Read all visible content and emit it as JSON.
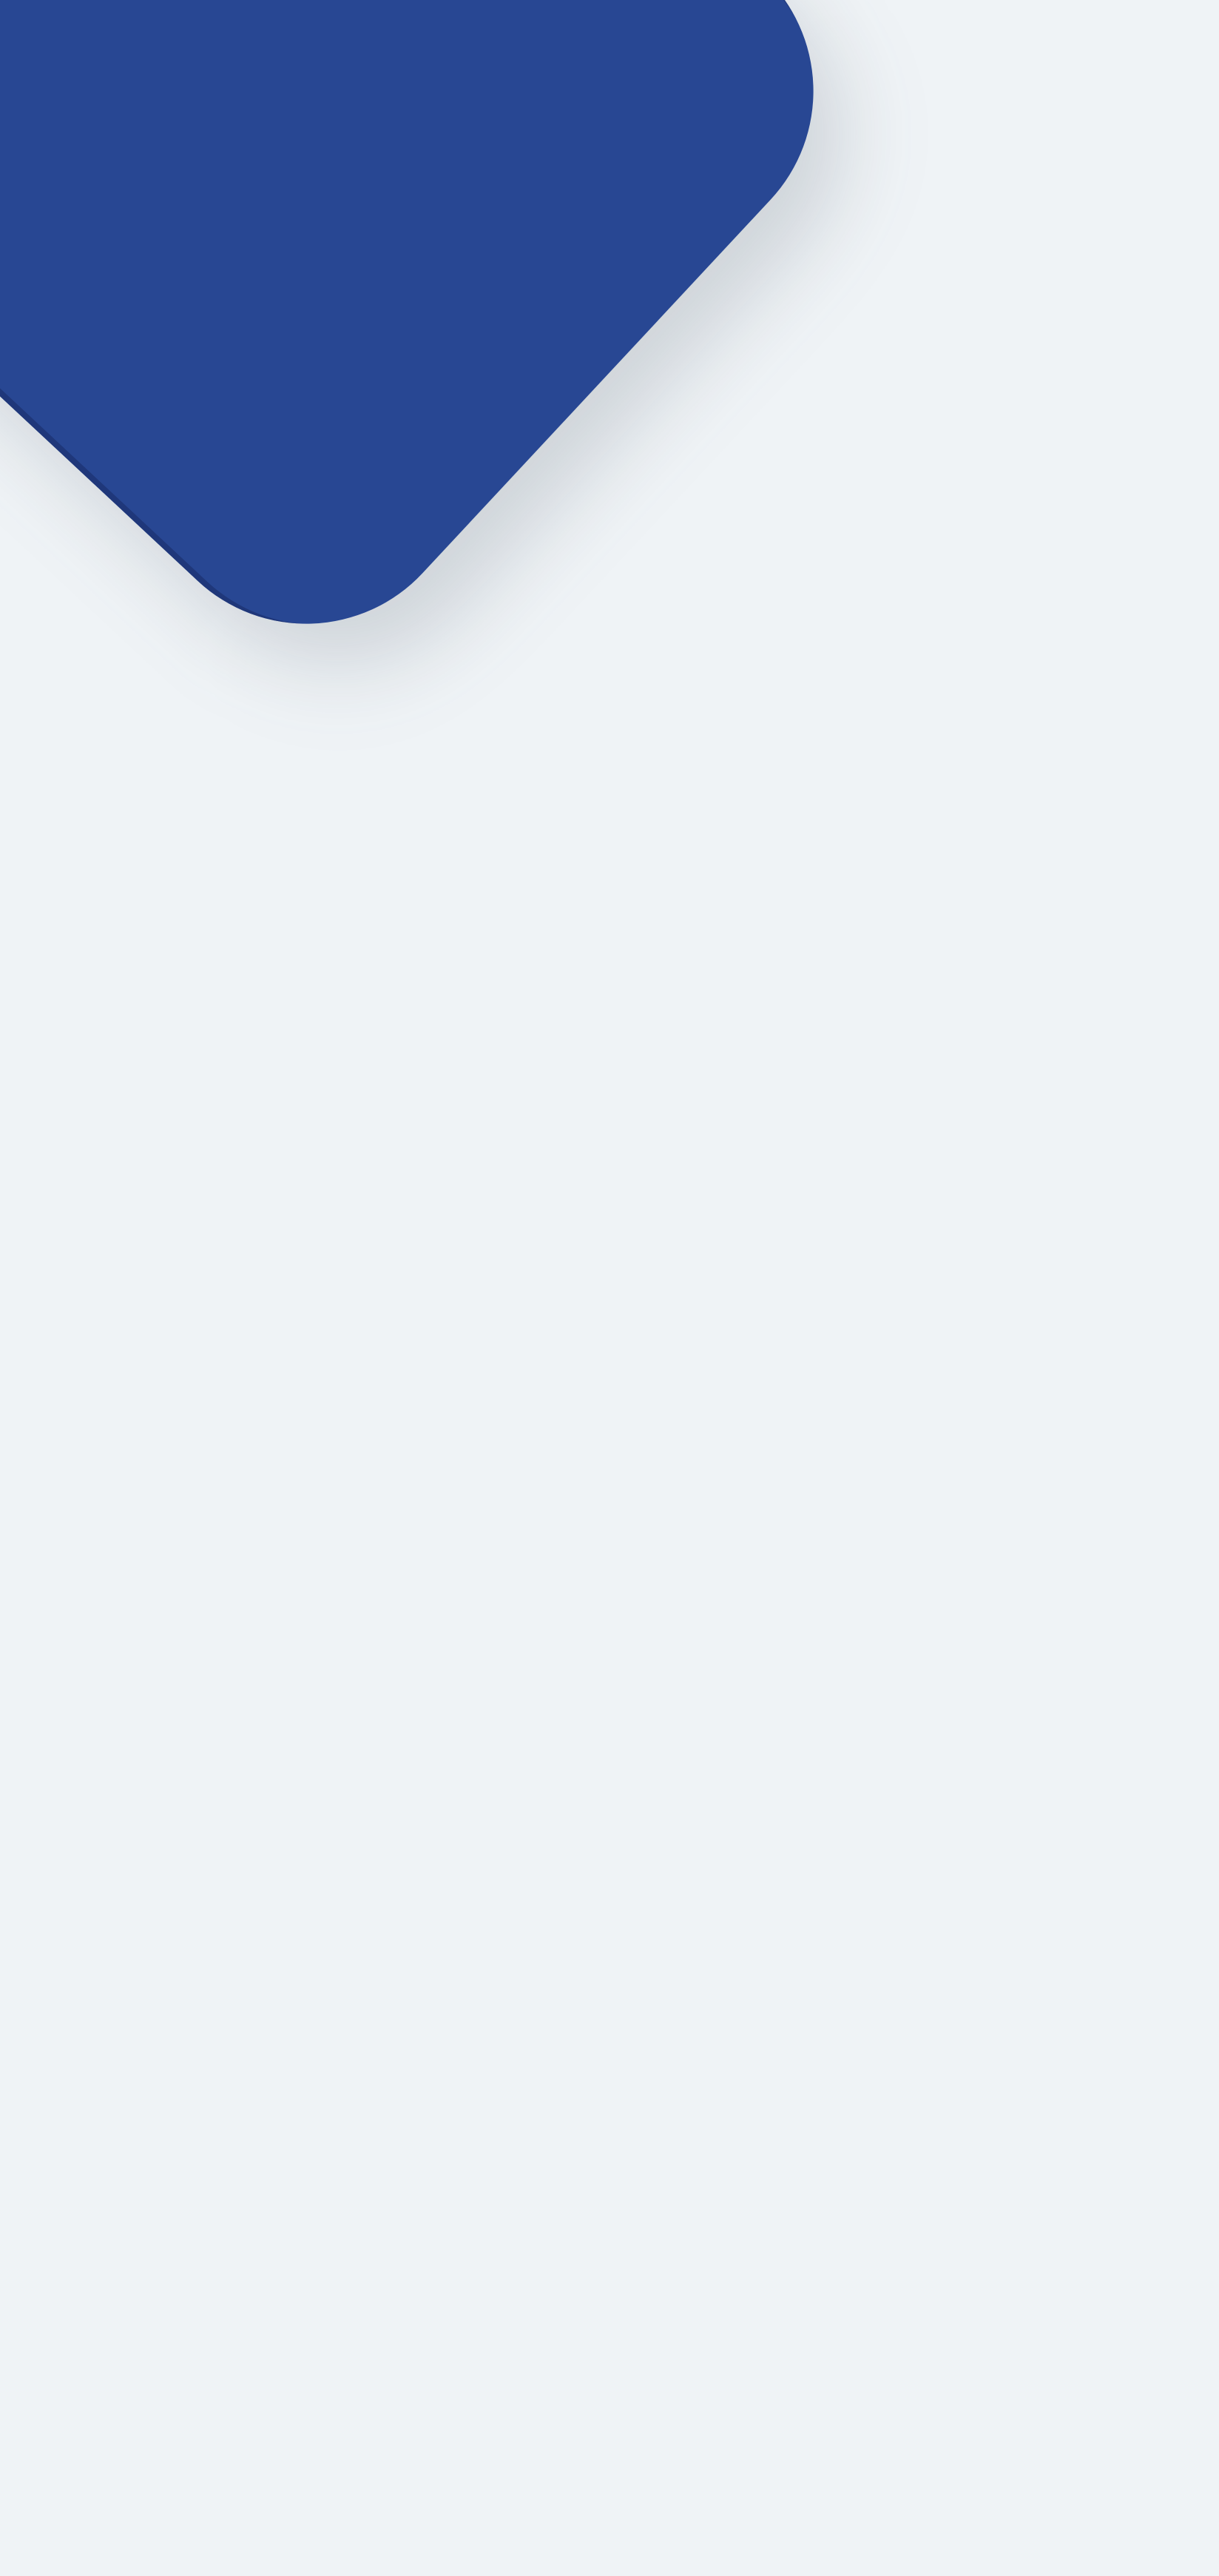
{
  "colors": {
    "background": "#eff3f6",
    "shape_fill": "#284793",
    "shape_edge": "#1e3b80"
  },
  "decoration": {
    "shape": "rounded-diamond",
    "shadow": "soft"
  }
}
